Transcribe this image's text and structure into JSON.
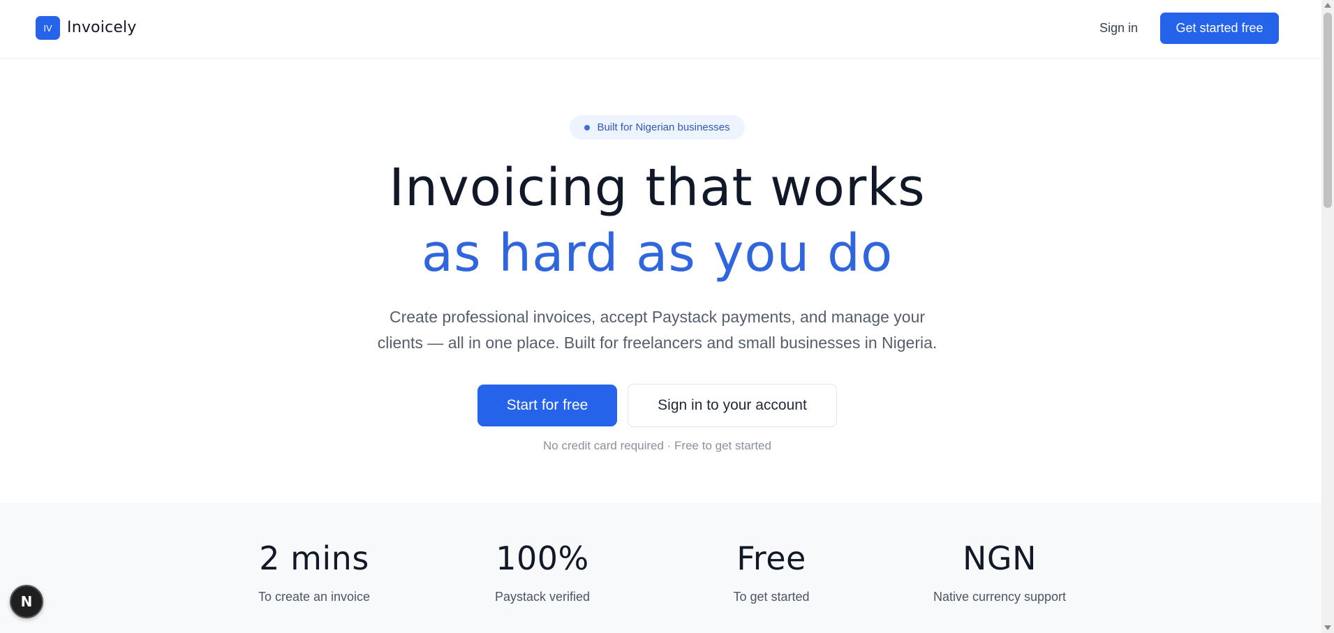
{
  "header": {
    "logo_mark": "IV",
    "brand": "Invoicely",
    "sign_in": "Sign in",
    "cta": "Get started free"
  },
  "hero": {
    "badge": "Built for Nigerian businesses",
    "title_line1": "Invoicing that works",
    "title_line2": "as hard as you do",
    "subtitle_line1": "Create professional invoices, accept Paystack payments, and manage your",
    "subtitle_line2": "clients — all in one place. Built for freelancers and small businesses in Nigeria.",
    "primary_button": "Start for free",
    "secondary_button": "Sign in to your account",
    "note": "No credit card required · Free to get started"
  },
  "stats": [
    {
      "value": "2 mins",
      "label": "To create an invoice"
    },
    {
      "value": "100%",
      "label": "Paystack verified"
    },
    {
      "value": "Free",
      "label": "To get started"
    },
    {
      "value": "NGN",
      "label": "Native currency support"
    }
  ],
  "fab": {
    "letter": "N",
    "icon": "nextjs-dev-indicator-icon"
  },
  "colors": {
    "accent": "#2563eb",
    "accent_text": "#2f66dd",
    "heading": "#111827",
    "muted": "#8a919c",
    "stats_bg": "#f8f9fb"
  }
}
